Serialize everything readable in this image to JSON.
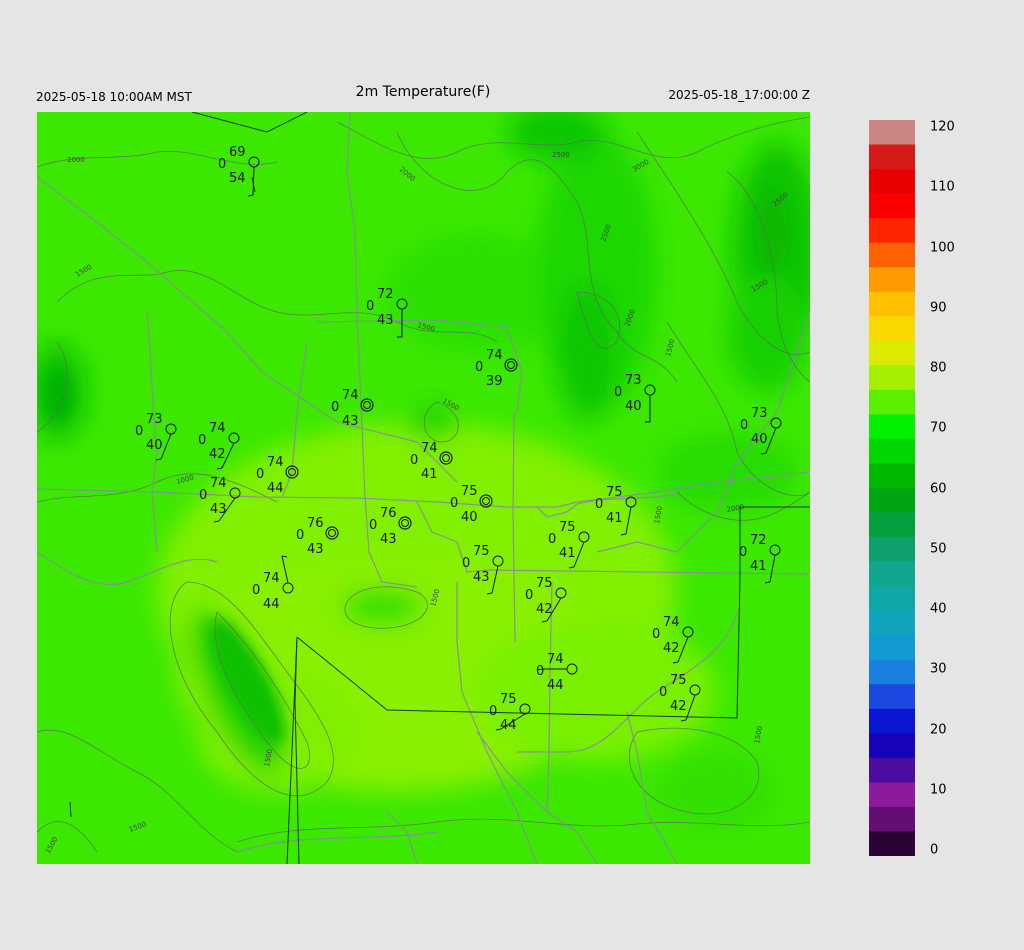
{
  "header": {
    "left": "2025-05-18 10:00AM MST",
    "title": "2m Temperature(F)",
    "right": "2025-05-18_17:00:00 Z"
  },
  "colorbar": {
    "labels": [
      "120",
      "110",
      "100",
      "90",
      "80",
      "70",
      "60",
      "50",
      "40",
      "30",
      "20",
      "10",
      "0"
    ],
    "stops": [
      {
        "v": 0,
        "c": "#0a0010"
      },
      {
        "v": 5,
        "c": "#5a0a6a"
      },
      {
        "v": 10,
        "c": "#8a1a9a"
      },
      {
        "v": 15,
        "c": "#3a0aa0"
      },
      {
        "v": 20,
        "c": "#0000c8"
      },
      {
        "v": 25,
        "c": "#1a3ae0"
      },
      {
        "v": 30,
        "c": "#1a80e0"
      },
      {
        "v": 35,
        "c": "#10a0d0"
      },
      {
        "v": 40,
        "c": "#10a8b0"
      },
      {
        "v": 45,
        "c": "#10a898"
      },
      {
        "v": 50,
        "c": "#10a070"
      },
      {
        "v": 55,
        "c": "#00a030"
      },
      {
        "v": 60,
        "c": "#00a800"
      },
      {
        "v": 65,
        "c": "#00d000"
      },
      {
        "v": 70,
        "c": "#00f000"
      },
      {
        "v": 75,
        "c": "#70f000"
      },
      {
        "v": 80,
        "c": "#c8f000"
      },
      {
        "v": 85,
        "c": "#f8e000"
      },
      {
        "v": 90,
        "c": "#ffc000"
      },
      {
        "v": 95,
        "c": "#ff9000"
      },
      {
        "v": 100,
        "c": "#ff4000"
      },
      {
        "v": 105,
        "c": "#ff0000"
      },
      {
        "v": 110,
        "c": "#e80000"
      },
      {
        "v": 115,
        "c": "#d02020"
      },
      {
        "v": 120,
        "c": "#c8c8c8"
      }
    ]
  },
  "contour_labels": [
    "2000",
    "2000",
    "2500",
    "3000",
    "2500",
    "2500",
    "2000",
    "1500",
    "1500",
    "1500",
    "1500",
    "1000",
    "1500",
    "2000",
    "1500",
    "1500",
    "1500",
    "1500",
    "1500",
    "1500"
  ],
  "stations": [
    {
      "t": "69",
      "cloud": "0",
      "td": "54",
      "calm": false
    },
    {
      "t": "72",
      "cloud": "0",
      "td": "43",
      "calm": false
    },
    {
      "t": "74",
      "cloud": "0",
      "td": "39",
      "calm": true
    },
    {
      "t": "73",
      "cloud": "0",
      "td": "40",
      "calm": false
    },
    {
      "t": "74",
      "cloud": "0",
      "td": "43",
      "calm": true
    },
    {
      "t": "73",
      "cloud": "0",
      "td": "40",
      "calm": false
    },
    {
      "t": "74",
      "cloud": "0",
      "td": "42",
      "calm": false
    },
    {
      "t": "74",
      "cloud": "0",
      "td": "41",
      "calm": true
    },
    {
      "t": "73",
      "cloud": "0",
      "td": "40",
      "calm": false
    },
    {
      "t": "74",
      "cloud": "0",
      "td": "44",
      "calm": true
    },
    {
      "t": "74",
      "cloud": "0",
      "td": "43",
      "calm": false
    },
    {
      "t": "75",
      "cloud": "0",
      "td": "40",
      "calm": true
    },
    {
      "t": "75",
      "cloud": "0",
      "td": "41",
      "calm": false
    },
    {
      "t": "76",
      "cloud": "0",
      "td": "43",
      "calm": true
    },
    {
      "t": "76",
      "cloud": "0",
      "td": "43",
      "calm": true
    },
    {
      "t": "75",
      "cloud": "0",
      "td": "41",
      "calm": false
    },
    {
      "t": "72",
      "cloud": "0",
      "td": "41",
      "calm": false
    },
    {
      "t": "75",
      "cloud": "0",
      "td": "43",
      "calm": false
    },
    {
      "t": "74",
      "cloud": "0",
      "td": "44",
      "calm": false
    },
    {
      "t": "75",
      "cloud": "0",
      "td": "42",
      "calm": false
    },
    {
      "t": "74",
      "cloud": "0",
      "td": "42",
      "calm": false
    },
    {
      "t": "74",
      "cloud": "0",
      "td": "44",
      "calm": false
    },
    {
      "t": "75",
      "cloud": "0",
      "td": "42",
      "calm": false
    },
    {
      "t": "75",
      "cloud": "0",
      "td": "44",
      "calm": false
    }
  ]
}
